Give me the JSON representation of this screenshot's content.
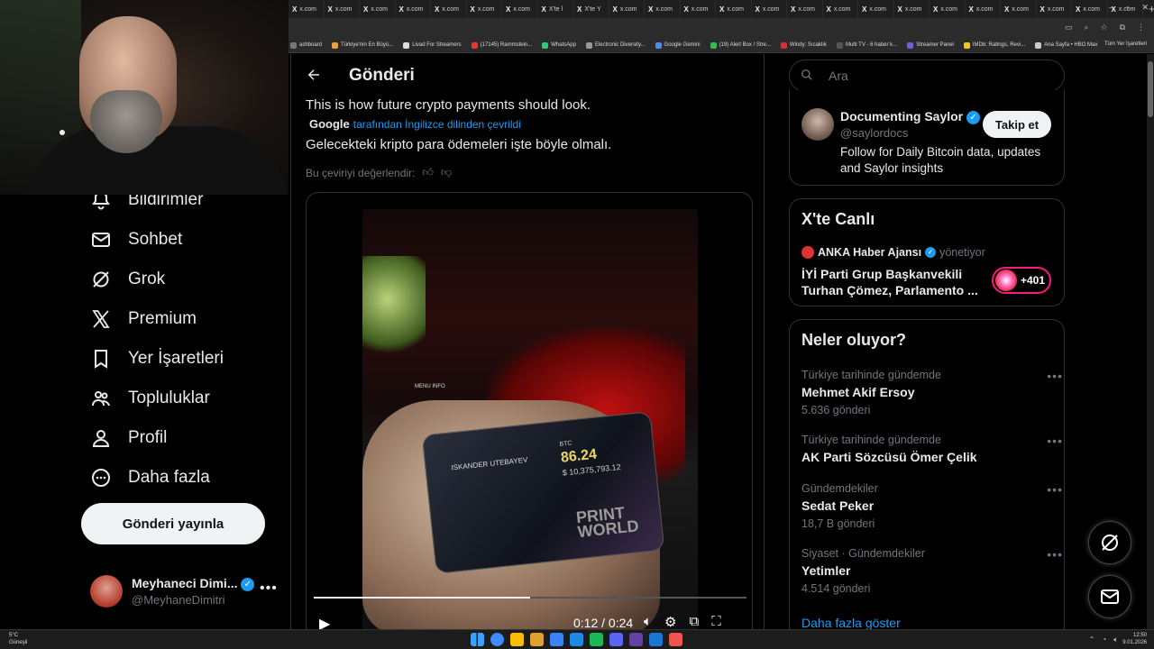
{
  "browser": {
    "tabs": [
      "x.com",
      "x.com",
      "x.com",
      "x.com",
      "x.com",
      "x.com",
      "x.com",
      "X'te l",
      "X'te Y",
      "x.com",
      "x.com",
      "x.com",
      "x.com",
      "x.com",
      "x.com",
      "x.com",
      "x.com",
      "x.com",
      "x.com",
      "x.com",
      "x.com",
      "x.com",
      "x.com",
      "x.com"
    ],
    "new_tab": "+",
    "window_controls": [
      "–",
      "▫",
      "✕"
    ],
    "bookmarks": [
      {
        "label": "ashboard",
        "color": "#777"
      },
      {
        "label": "Türkiye'nin En Büyü...",
        "color": "#e8a33d"
      },
      {
        "label": "Livad For Streamers",
        "color": "#ddd"
      },
      {
        "label": "(17145) Rammstein...",
        "color": "#e33"
      },
      {
        "label": "WhatsApp",
        "color": "#2ecc71"
      },
      {
        "label": "Electronic Diversity...",
        "color": "#999"
      },
      {
        "label": "Google Gemini",
        "color": "#4c8bf5"
      },
      {
        "label": "(19) Alert Box / Stre...",
        "color": "#3b5"
      },
      {
        "label": "Windy: Sıcaklık",
        "color": "#c33"
      },
      {
        "label": "Multi TV - 6 haber k...",
        "color": "#555"
      },
      {
        "label": "Streamer Panel",
        "color": "#66c"
      },
      {
        "label": "IMDb: Ratings, Revi...",
        "color": "#f5c518"
      },
      {
        "label": "Ana Sayfa • HBO Max",
        "color": "#ccc"
      }
    ],
    "all_bookmarks": "Tüm Yer İşaretleri"
  },
  "nav": {
    "items": [
      {
        "label": "Bildirimler",
        "icon": "bell-icon"
      },
      {
        "label": "Sohbet",
        "icon": "mail-icon"
      },
      {
        "label": "Grok",
        "icon": "grok-icon"
      },
      {
        "label": "Premium",
        "icon": "x-logo-icon"
      },
      {
        "label": "Yer İşaretleri",
        "icon": "bookmark-icon"
      },
      {
        "label": "Topluluklar",
        "icon": "communities-icon"
      },
      {
        "label": "Profil",
        "icon": "person-icon"
      },
      {
        "label": "Daha fazla",
        "icon": "more-circle-icon"
      }
    ],
    "post_button": "Gönderi yayınla",
    "profile": {
      "name": "Meyhaneci Dimi...",
      "handle": "@MeyhaneDimitri",
      "more": "•••"
    }
  },
  "main": {
    "title": "Gönderi",
    "original_text": "This is how future crypto payments should look.",
    "translation": {
      "provider": "Google",
      "note": "tarafından İngilizce dilinden çevrildi"
    },
    "translated_text": "Gelecekteki kripto para ödemeleri işte böyle olmalı.",
    "rate_label": "Bu çeviriyi değerlendir:",
    "video": {
      "time": "0:12 / 0:24",
      "progress": 0.5,
      "card": {
        "name": "ISKANDER UTEBAYEV",
        "ticker": "BTC",
        "btc_value": "86.24",
        "usd_value": "$ 10,375,793.12",
        "logo": "PRINT WORLD",
        "menu": "MENU   INFO"
      }
    }
  },
  "right": {
    "search_placeholder": "Ara",
    "follow": {
      "name": "Documenting Saylor",
      "handle": "@saylordocs",
      "bio": "Follow for Daily Bitcoin data, updates and Saylor insights",
      "button": "Takip et"
    },
    "live": {
      "title": "X'te Canlı",
      "host": "ANKA Haber Ajansı",
      "role": "yönetiyor",
      "stream_title": "İYİ Parti Grup Başkanvekili Turhan Çömez, Parlamento ...",
      "count": "+401"
    },
    "trends_title": "Neler oluyor?",
    "trends": [
      {
        "context": "Türkiye tarihinde gündemde",
        "title": "Mehmet Akif Ersoy",
        "count": "5.636 gönderi"
      },
      {
        "context": "Türkiye tarihinde gündemde",
        "title": "AK Parti Sözcüsü Ömer Çelik",
        "count": ""
      },
      {
        "context": "Gündemdekiler",
        "title": "Sedat Peker",
        "count": "18,7 B gönderi"
      },
      {
        "context": "Siyaset · Gündemdekiler",
        "title": "Yetimler",
        "count": "4.514 gönderi"
      }
    ],
    "show_more": "Daha fazla göster"
  },
  "taskbar": {
    "weather_temp": "5°C",
    "weather_desc": "Güneşli",
    "time": "12:50",
    "date": "9.01.2026",
    "apps": [
      "#3d8bfd",
      "#fbbc05",
      "#e0a030",
      "#3b82f6",
      "#1e88e5",
      "#1db954",
      "#5865f2",
      "#6441a5",
      "#1976d2",
      "#ef5350"
    ]
  }
}
